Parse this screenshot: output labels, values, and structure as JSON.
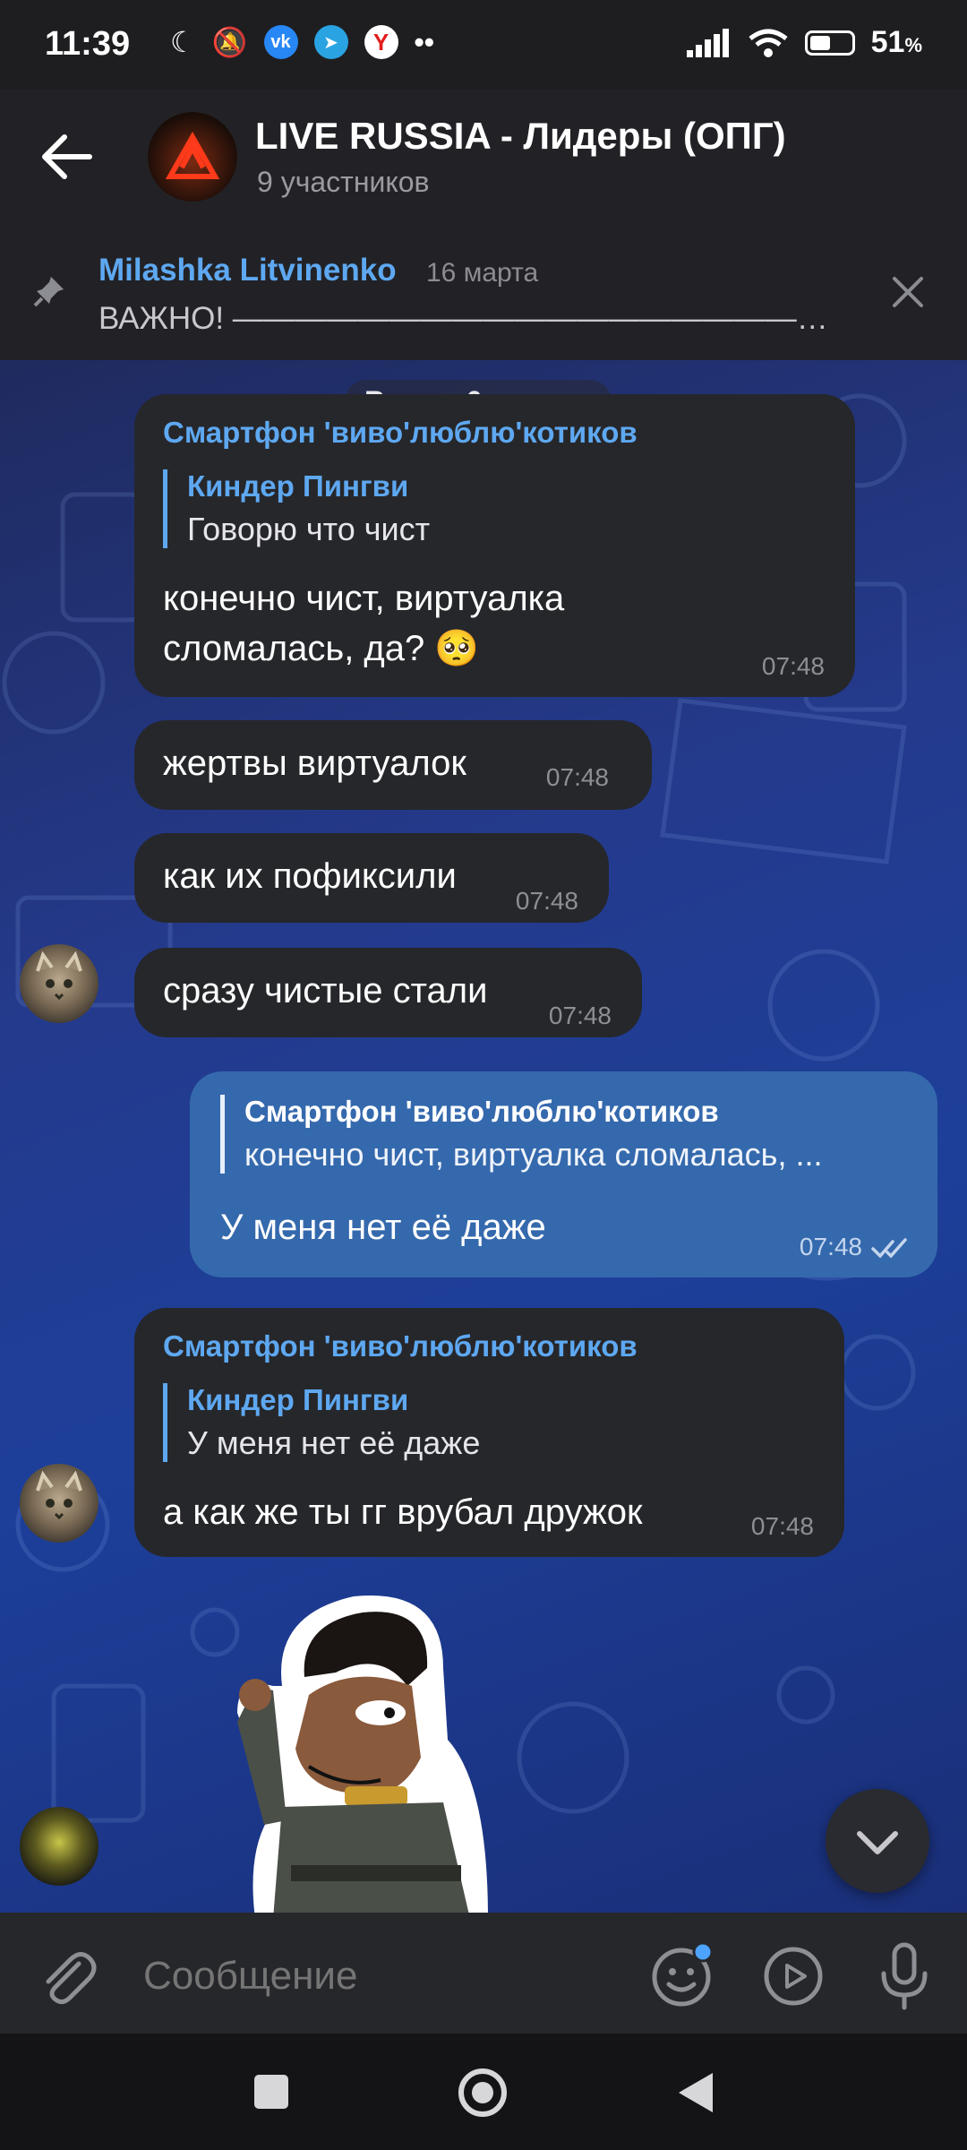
{
  "status_bar": {
    "time": "11:39",
    "battery": "51",
    "battery_unit": "%",
    "battery_level": 0.51
  },
  "header": {
    "title": "LIVE RUSSIA - Лидеры (ОПГ)",
    "subtitle": "9 участников"
  },
  "pinned": {
    "author": "Milashka Litvinenko",
    "date": "16 марта",
    "text": "ВАЖНО! ——————————————————— И..."
  },
  "chat": {
    "date_chip": "Вчера, 6 апреля",
    "messages": [
      {
        "sender": "Смартфон 'виво'люблю'котиков",
        "reply_name": "Киндер Пингви",
        "reply_text": "Говорю что чист",
        "text_line1": "конечно чист, виртуалка",
        "text_line2": "сломалась, да? 🥺",
        "time": "07:48"
      },
      {
        "text": "жертвы виртуалок",
        "time": "07:48"
      },
      {
        "text": "как их пофиксили",
        "time": "07:48"
      },
      {
        "text": "сразу чистые стали",
        "time": "07:48"
      },
      {
        "reply_name": "Смартфон 'виво'люблю'котиков",
        "reply_text": "конечно чист, виртуалка сломалась, ...",
        "text": "У меня нет её даже",
        "time": "07:48"
      },
      {
        "sender": "Смартфон 'виво'люблю'котиков",
        "reply_name": "Киндер Пингви",
        "reply_text": "У меня нет её даже",
        "text": "а как же ты гг врубал дружок",
        "time": "07:48"
      }
    ]
  },
  "input": {
    "placeholder": "Сообщение"
  },
  "colors": {
    "accent": "#5ea8f1",
    "outgoing_bubble": "#3569ad",
    "incoming_bubble": "#26272b"
  }
}
